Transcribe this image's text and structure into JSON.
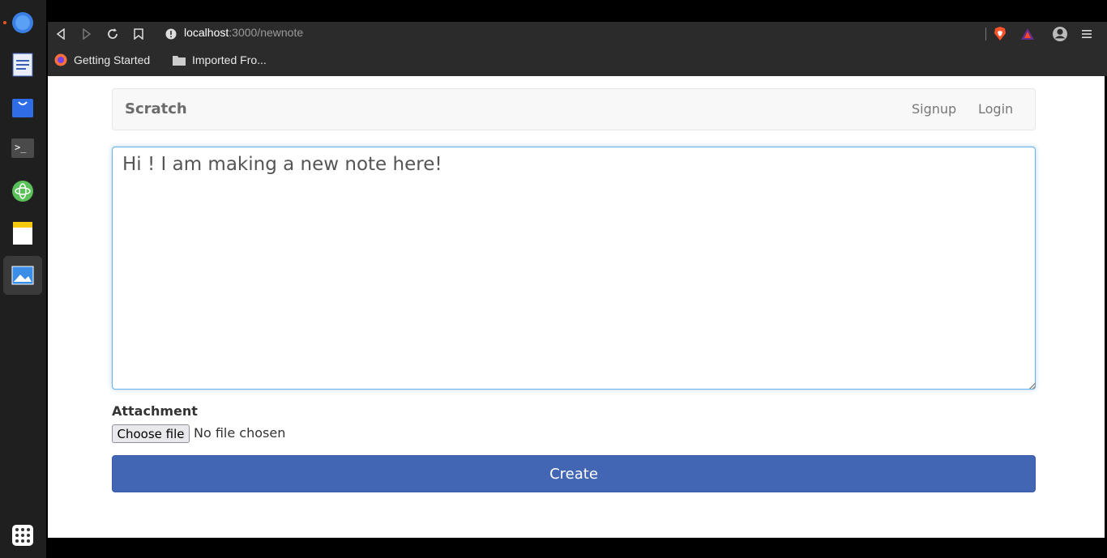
{
  "browser": {
    "url_host": "localhost",
    "url_path": ":3000/newnote",
    "bookmarks": [
      {
        "label": "Getting Started"
      },
      {
        "label": "Imported Fro..."
      }
    ]
  },
  "navbar": {
    "brand": "Scratch",
    "links": [
      "Signup",
      "Login"
    ]
  },
  "form": {
    "note_value": "Hi ! I am making a new note here!",
    "attachment_label": "Attachment",
    "choose_file_label": "Choose file",
    "file_status": "No file chosen",
    "create_label": "Create"
  },
  "colors": {
    "accent": "#4366b4",
    "focus": "#66afe9"
  }
}
